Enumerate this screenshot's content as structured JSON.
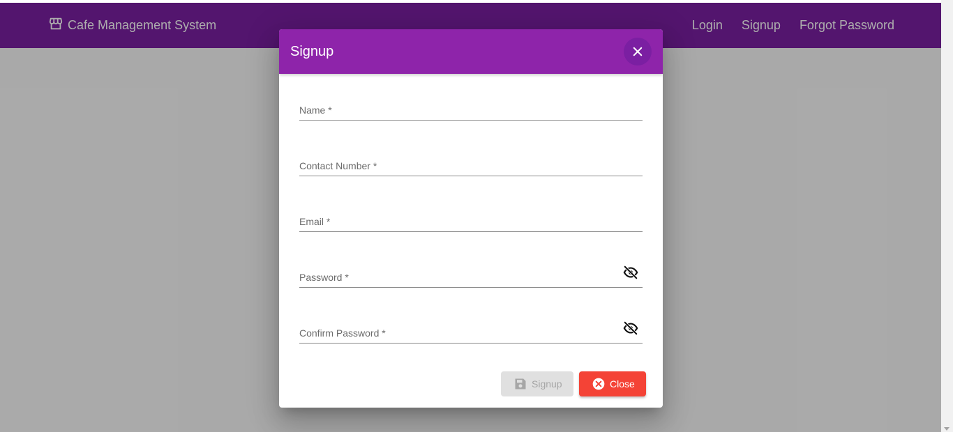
{
  "navbar": {
    "brand_icon": "storefront-icon",
    "brand_title": "Cafe Management System",
    "links": [
      "Login",
      "Signup",
      "Forgot Password"
    ],
    "color": "#7b1fa2"
  },
  "dialog": {
    "title": "Signup",
    "header_color": "#8e24aa",
    "fields": {
      "name": {
        "label": "Name *",
        "value": ""
      },
      "contact": {
        "label": "Contact Number *",
        "value": ""
      },
      "email": {
        "label": "Email *",
        "value": ""
      },
      "password": {
        "label": "Password *",
        "value": "",
        "toggle_icon": "visibility-off-icon"
      },
      "confirm_password": {
        "label": "Confirm Password *",
        "value": "",
        "toggle_icon": "visibility-off-icon"
      }
    },
    "buttons": {
      "signup": {
        "label": "Signup",
        "icon": "save-icon",
        "disabled": true
      },
      "close": {
        "label": "Close",
        "icon": "cancel-icon",
        "color": "#f44336"
      }
    }
  }
}
